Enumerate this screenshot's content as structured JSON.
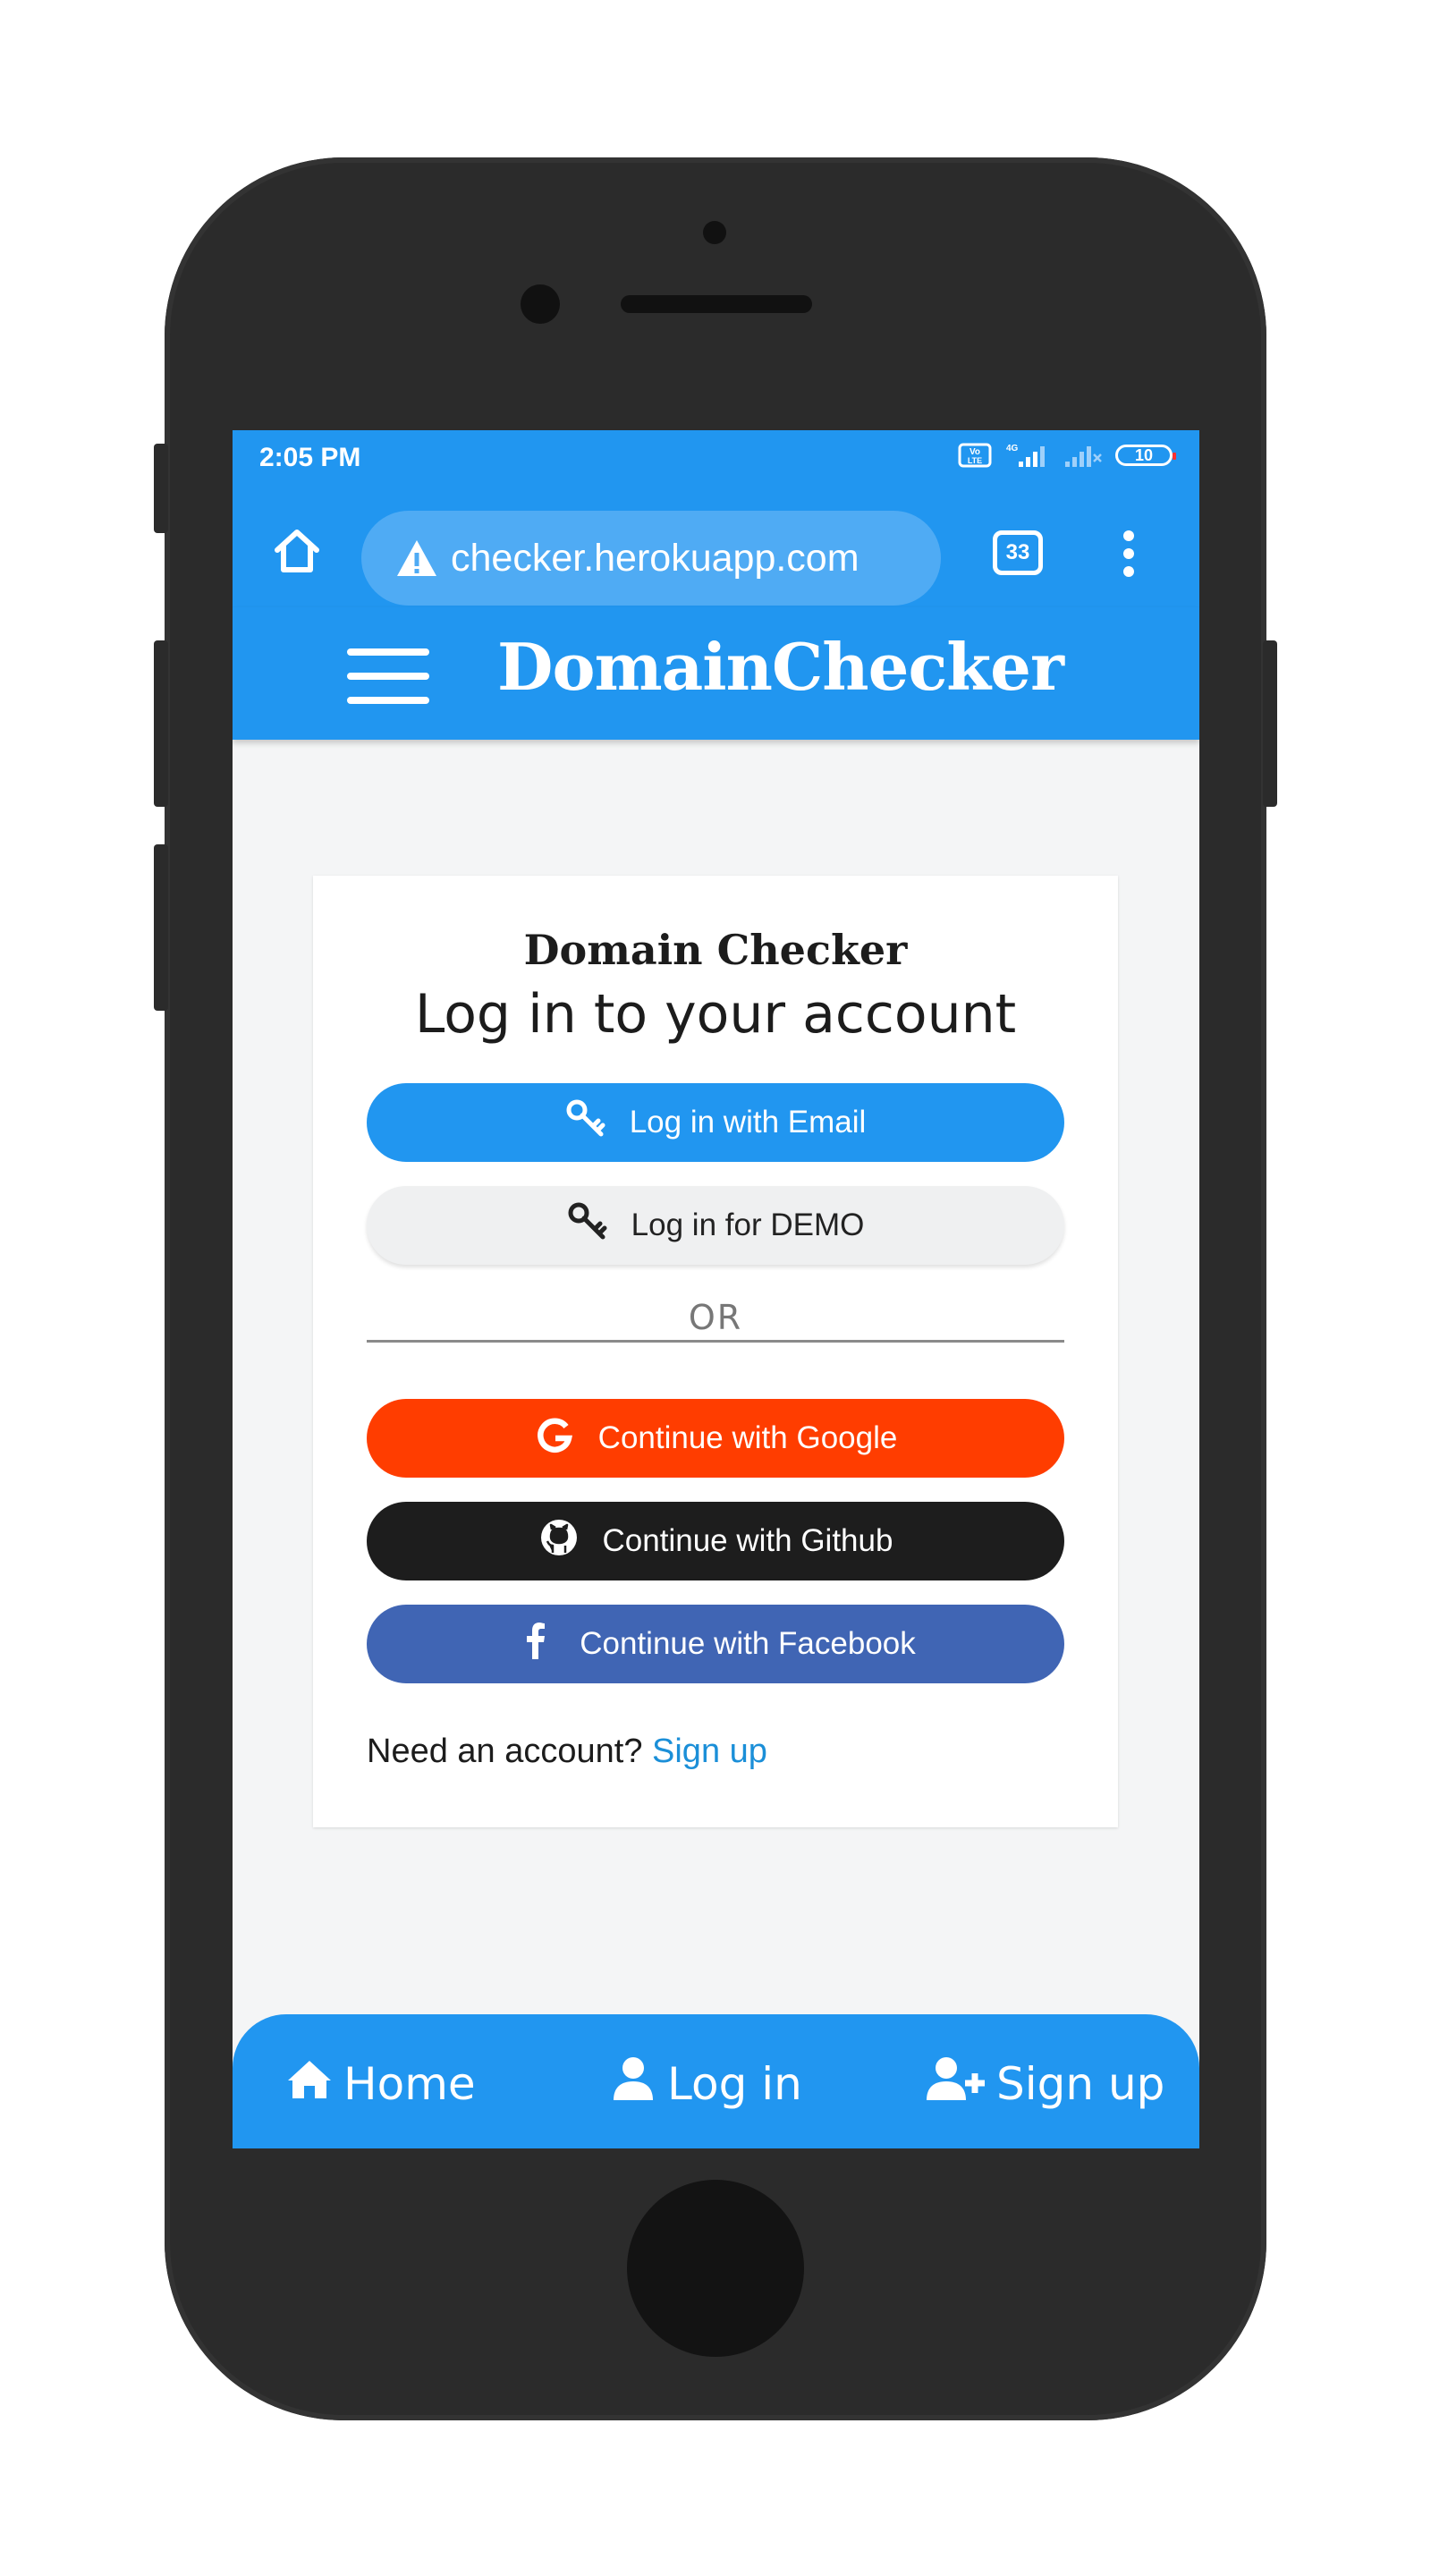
{
  "status_bar": {
    "time": "2:05 PM",
    "volte_label": "Vo LTE",
    "network_label": "4G",
    "battery_level": "10"
  },
  "browser": {
    "url": "checker.herokuapp.com",
    "tab_count": "33",
    "icons": [
      "home-icon",
      "warning-icon",
      "tabs-icon",
      "more-vert-icon"
    ]
  },
  "navbar": {
    "brand": "DomainChecker",
    "menu_icon": "hamburger-icon"
  },
  "login_card": {
    "brand": "Domain Checker",
    "title": "Log in to your account",
    "email_button": "Log in with Email",
    "demo_button": "Log in for DEMO",
    "or_label": "OR",
    "google_button": "Continue with Google",
    "github_button": "Continue with Github",
    "facebook_button": "Continue with Facebook",
    "signup_prompt": "Need an account?",
    "signup_link": "Sign up"
  },
  "bottom_nav": {
    "home": "Home",
    "login": "Log in",
    "signup": "Sign up"
  },
  "colors": {
    "primary": "#2196f0",
    "google": "#ff3d00",
    "github": "#1d1d1d",
    "facebook": "#4065b4",
    "link": "#1b8fd8"
  }
}
